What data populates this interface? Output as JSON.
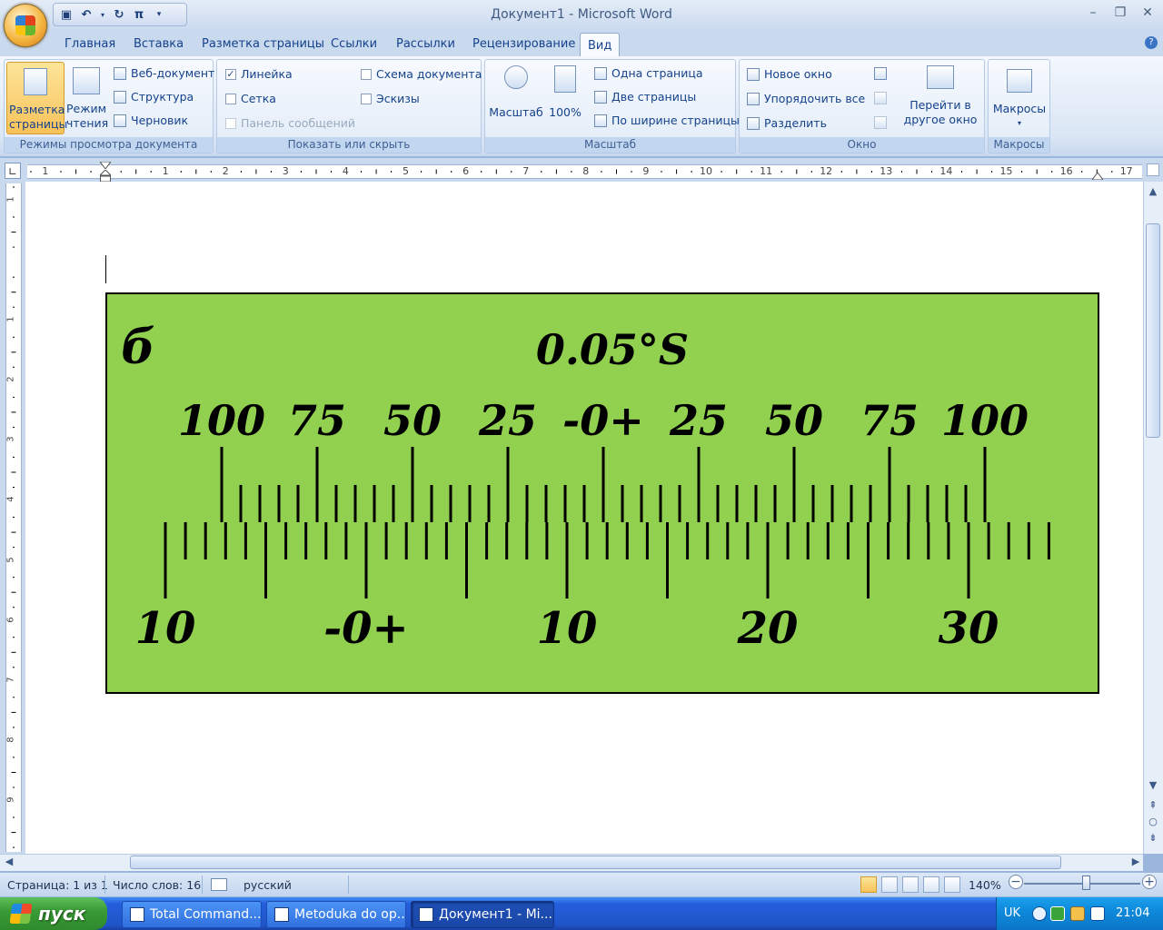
{
  "window": {
    "title": "Документ1 - Microsoft Word"
  },
  "ribbon": {
    "tabs": [
      "Главная",
      "Вставка",
      "Разметка страницы",
      "Ссылки",
      "Рассылки",
      "Рецензирование",
      "Вид"
    ],
    "active_tab": "Вид",
    "groups": {
      "views": {
        "label": "Режимы просмотра документа",
        "print_layout": "Разметка страницы",
        "reading": "Режим чтения",
        "web": "Веб-документ",
        "outline": "Структура",
        "draft": "Черновик"
      },
      "show_hide": {
        "label": "Показать или скрыть",
        "ruler": "Линейка",
        "ruler_checked": true,
        "grid": "Сетка",
        "message_bar": "Панель сообщений",
        "doc_map": "Схема документа",
        "thumbnails": "Эскизы"
      },
      "zoom": {
        "label": "Масштаб",
        "zoom": "Масштаб",
        "hundred": "100%",
        "one_page": "Одна страница",
        "two_pages": "Две страницы",
        "page_width": "По ширине страницы"
      },
      "window": {
        "label": "Окно",
        "new_window": "Новое окно",
        "arrange_all": "Упорядочить все",
        "split": "Разделить",
        "switch_windows": "Перейти в другое окно"
      },
      "macros": {
        "label": "Макросы",
        "macros": "Макросы"
      }
    }
  },
  "ruler": {
    "h_numbers": [
      "1",
      "1",
      "2",
      "3",
      "4",
      "5",
      "6",
      "7",
      "8",
      "9",
      "10",
      "11",
      "12",
      "13",
      "14",
      "15",
      "16",
      "17"
    ],
    "v_numbers": [
      "1",
      "1",
      "2",
      "3",
      "4",
      "5",
      "6",
      "7",
      "8",
      "9"
    ]
  },
  "document": {
    "figure": {
      "label": "б",
      "precision": "0.05°S",
      "upper_scale": [
        "100",
        "75",
        "50",
        "25",
        "-0+",
        "25",
        "50",
        "75",
        "100"
      ],
      "lower_scale": [
        "10",
        "-0+",
        "10",
        "20",
        "30"
      ],
      "background": "#92d050"
    }
  },
  "status": {
    "page": "Страница: 1 из 1",
    "words": "Число слов: 16",
    "language": "русский",
    "zoom": "140%",
    "zoom_fraction": 0.53
  },
  "taskbar": {
    "start": "пуск",
    "tasks": [
      "Total Command...",
      "Metoduka do op...",
      "Документ1 - Mi..."
    ],
    "lang": "UK",
    "clock": "21:04"
  }
}
